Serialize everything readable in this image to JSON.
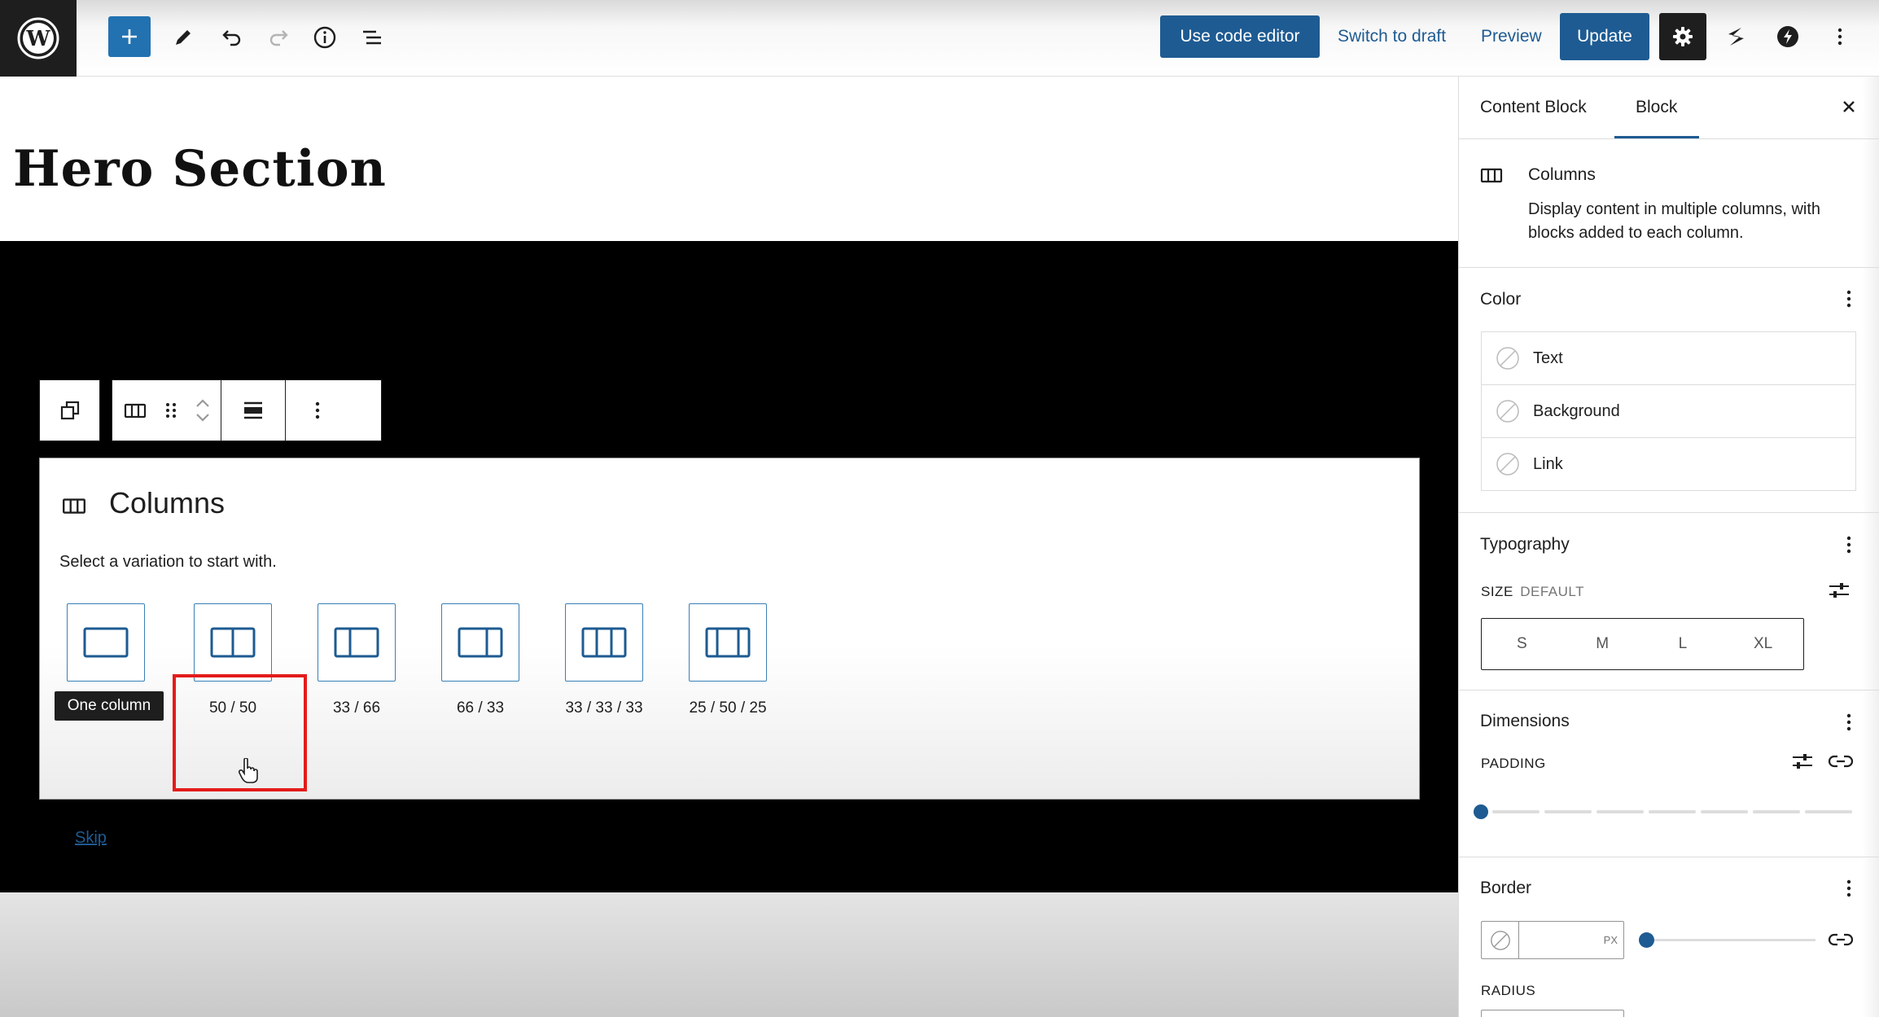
{
  "topbar": {
    "code_editor_label": "Use code editor",
    "switch_to_draft_label": "Switch to draft",
    "preview_label": "Preview",
    "update_label": "Update"
  },
  "canvas": {
    "page_title": "Hero Section"
  },
  "placeholder": {
    "title": "Columns",
    "instructions": "Select a variation to start with.",
    "variations": [
      {
        "label": "One column"
      },
      {
        "label": "50 / 50"
      },
      {
        "label": "33 / 66"
      },
      {
        "label": "66 / 33"
      },
      {
        "label": "33 / 33 / 33"
      },
      {
        "label": "25 / 50 / 25"
      }
    ],
    "tooltip": "One column",
    "skip_label": "Skip"
  },
  "sidebar": {
    "tabs": [
      {
        "label": "Content Block",
        "active": false
      },
      {
        "label": "Block",
        "active": true
      }
    ],
    "block_card": {
      "title": "Columns",
      "description_line1": "Display content in multiple columns, with",
      "description_line2": "blocks added to each column."
    },
    "color": {
      "title": "Color",
      "items": [
        {
          "label": "Text"
        },
        {
          "label": "Background"
        },
        {
          "label": "Link"
        }
      ]
    },
    "typography": {
      "title": "Typography",
      "size_label": "SIZE",
      "size_value": "DEFAULT",
      "sizes": [
        "S",
        "M",
        "L",
        "XL"
      ]
    },
    "dimensions": {
      "title": "Dimensions",
      "padding_label": "PADDING"
    },
    "border": {
      "title": "Border",
      "unit": "PX",
      "radius_label": "RADIUS"
    }
  },
  "colors": {
    "accent": "#1e5b92",
    "highlight": "#e41b1b",
    "hero_background": "#000000"
  }
}
